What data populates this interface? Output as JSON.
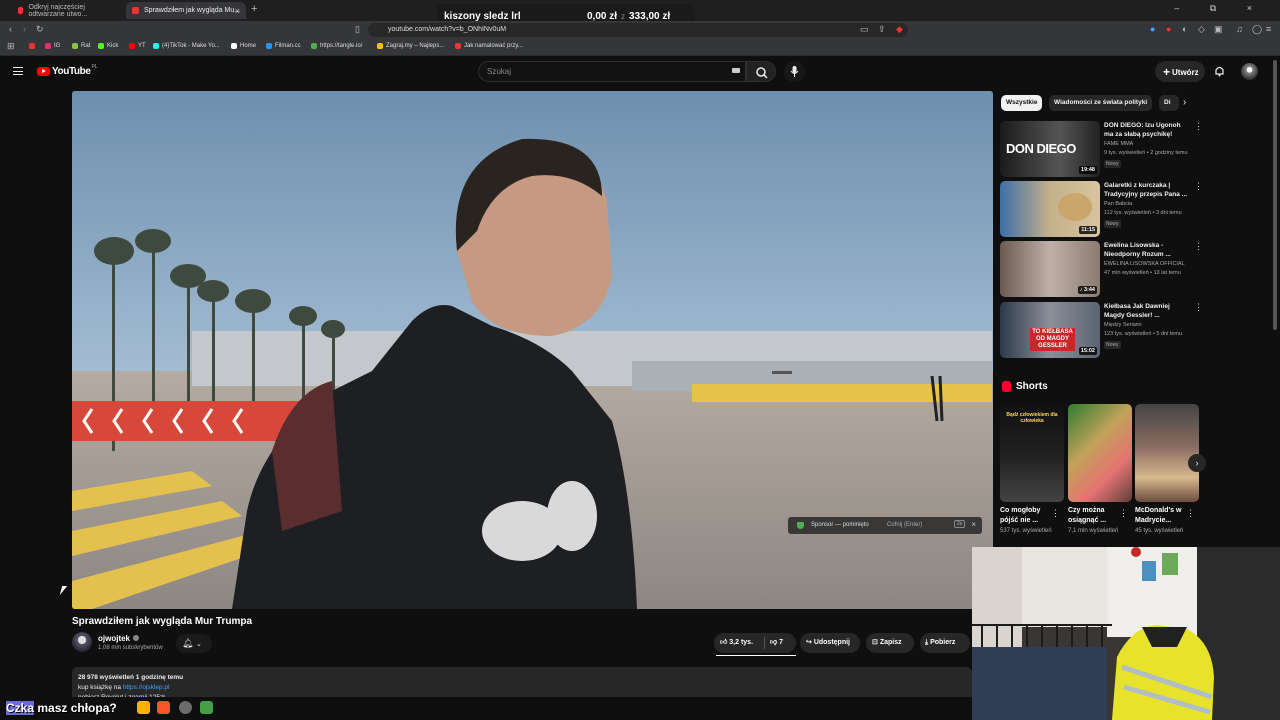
{
  "browser": {
    "tabs": [
      {
        "label": "Odkryj najczęściej odtwarzane utwo..."
      },
      {
        "label": "Sprawdziłem jak wygląda Mu..."
      }
    ],
    "new_tab": "+",
    "window_controls": "–  ⧉  ×",
    "address": "youtube.com/watch?v=b_ONhINv0uM",
    "bookmarks": [
      {
        "label": "IG",
        "color": "#e1306c"
      },
      {
        "label": "Rat",
        "color": "#8bc34a"
      },
      {
        "label": "Kick",
        "color": "#53fc18"
      },
      {
        "label": "YT",
        "color": "#ff0000"
      },
      {
        "label": "(4)TikTok - Make Yo...",
        "color": "#25f4ee"
      },
      {
        "label": "Home",
        "color": "#ffffff"
      },
      {
        "label": "Filman.cc",
        "color": "#2196f3"
      },
      {
        "label": "https://tangle.io/",
        "color": "#4caf50"
      },
      {
        "label": "Zagraj.my – Najleps...",
        "color": "#ffc107"
      },
      {
        "label": "Jak namalować przy...",
        "color": "#e53935"
      }
    ]
  },
  "overlay": {
    "title": "kiszony sledz lrl",
    "amount": "0,00 zł",
    "separator": "z",
    "goal": "333,00 zł"
  },
  "youtube": {
    "logo": "YouTube",
    "country": "PL",
    "search_placeholder": "Szukaj",
    "create_label": "Utwórz",
    "icons": [
      "menu-icon",
      "search-icon",
      "mic-icon",
      "bell-icon",
      "keyboard-icon"
    ]
  },
  "video": {
    "title": "Sprawdziłem jak wygląda Mur Trumpa",
    "channel": "ojwojtek",
    "subscribers": "1,08 mln subskrybentów",
    "likes": "3,2 tys.",
    "dislikes": "7",
    "share": "Udostępnij",
    "save": "Zapisz",
    "download": "Pobierz",
    "skip_toast": {
      "label": "Sponsor — pominięto",
      "undo": "Cofnij (Enter)",
      "key": "2s"
    },
    "description": {
      "stats": "28 978 wyświetleń  1 godzinę temu",
      "line2_prefix": "kup książkę na ",
      "link": "https://ojsklep.pl",
      "line3": "pobierz Revolut i zgarnij 125zł"
    }
  },
  "sidebar": {
    "chips": [
      "Wszystkie",
      "Wiadomości ze świata polityki",
      "Di"
    ],
    "recommendations": [
      {
        "title": "DON DIEGO: Izu Ugonoh ma za słabą psychikę!",
        "channel": "FAME MMA",
        "meta": "9 tys. wyświetleń • 2 godziny temu",
        "badge": "Nowy",
        "duration": "19:48",
        "thumb_text": "DON DIEGO"
      },
      {
        "title": "Galaretki z kurczaka | Tradycyjny przepis Pana ...",
        "channel": "Pan Babcia",
        "meta": "112 tys. wyświetleń • 3 dni temu",
        "badge": "Nowy",
        "duration": "11:15",
        "thumb_text": ""
      },
      {
        "title": "Ewelina Lisowska - Nieodporny Rozum ...",
        "channel": "EWELINA LISOWSKA OFFICIAL",
        "meta": "47 mln wyświetleń • 13 lat temu",
        "badge": "",
        "duration": "3:44",
        "thumb_text": ""
      },
      {
        "title": "Kiełbasa Jak Dawniej Magdy Gessler! ...",
        "channel": "Między Seriami",
        "meta": "123 tys. wyświetleń • 5 dni temu",
        "badge": "Nowy",
        "duration": "15:02",
        "thumb_text": "TO KIEŁBASA OD MAGDY GESSLER"
      }
    ],
    "shorts_title": "Shorts",
    "shorts": [
      {
        "title": "Co mogłoby pójść nie ...",
        "views": "537 tys. wyświetleń",
        "thumb_text": "Bądź człowiekiem dla człowieka"
      },
      {
        "title": "Czy można osiągnąć ...",
        "views": "7,1 mln wyświetleń",
        "thumb_text": ""
      },
      {
        "title": "McDonald's w Madrycie...",
        "views": "45 tys. wyświetleń",
        "thumb_text": ""
      }
    ]
  },
  "stream": {
    "chat_highlight": "Czka",
    "chat_text": " masz chłopa?"
  }
}
